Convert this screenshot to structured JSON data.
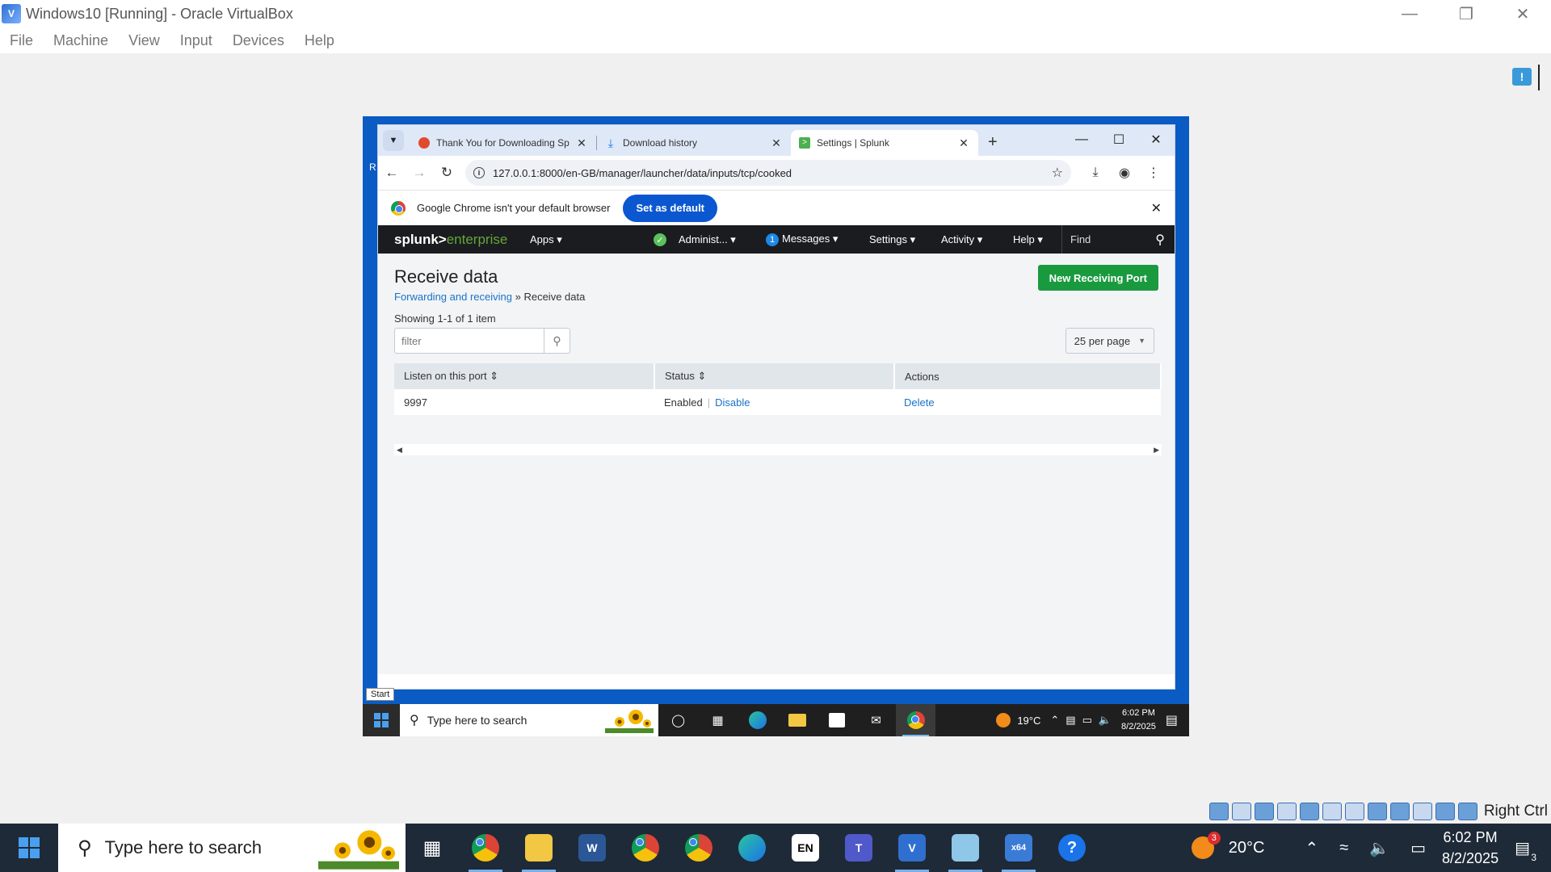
{
  "host": {
    "title": "Windows10 [Running] - Oracle VirtualBox",
    "menu": [
      "File",
      "Machine",
      "View",
      "Input",
      "Devices",
      "Help"
    ],
    "status_host_key": "Right Ctrl"
  },
  "chrome": {
    "tabs": [
      {
        "label": "Thank You for Downloading Sp",
        "favicon_color": "#e04a2f"
      },
      {
        "label": "Download history",
        "favicon": "download-icon"
      },
      {
        "label": "Settings | Splunk",
        "favicon_color": "#4caf50",
        "active": true
      }
    ],
    "url": "127.0.0.1:8000/en-GB/manager/launcher/data/inputs/tcp/cooked",
    "infobar": {
      "message": "Google Chrome isn't your default browser",
      "button": "Set as default"
    }
  },
  "splunk": {
    "logo_main": "splunk>",
    "logo_sub": "enterprise",
    "nav": {
      "apps": "Apps",
      "admin": "Administ...",
      "messages_count": "1",
      "messages": "Messages",
      "settings": "Settings",
      "activity": "Activity",
      "help": "Help",
      "find": "Find"
    },
    "page": {
      "title": "Receive data",
      "new_button": "New Receiving Port",
      "crumb_link": "Forwarding and receiving",
      "crumb_sep": "»",
      "crumb_current": "Receive data",
      "count": "Showing 1-1 of 1 item",
      "filter_placeholder": "filter",
      "per_page": "25 per page"
    },
    "table": {
      "headers": [
        "Listen on this port",
        "Status",
        "Actions"
      ],
      "rows": [
        {
          "port": "9997",
          "status": "Enabled",
          "toggle": "Disable",
          "action": "Delete"
        }
      ]
    }
  },
  "guest": {
    "start_tooltip": "Start",
    "search_placeholder": "Type here to search",
    "weather": "19°C",
    "time": "6:02 PM",
    "date": "8/2/2025"
  },
  "host_taskbar": {
    "search_placeholder": "Type here to search",
    "lang": "EN",
    "weather": "20°C",
    "weather_badge": "3",
    "time": "6:02 PM",
    "date": "8/2/2025",
    "notif_count": "3"
  }
}
